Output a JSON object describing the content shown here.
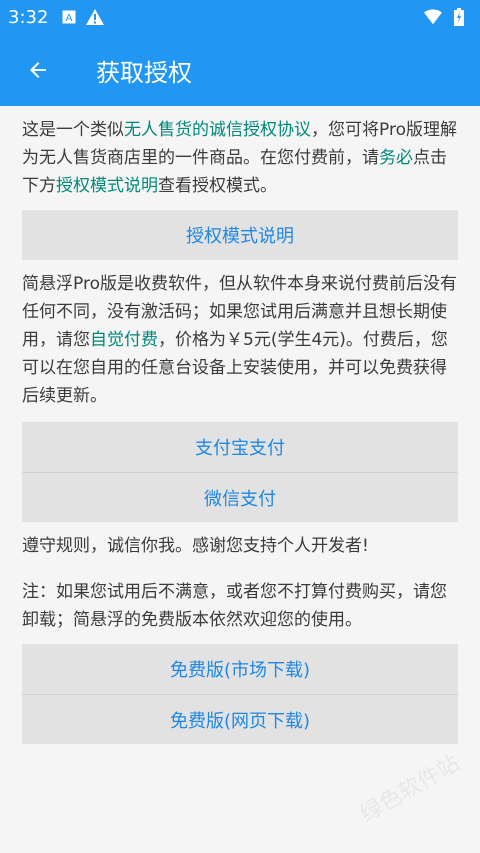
{
  "status": {
    "time": "3:32",
    "icons": [
      "a-box-icon",
      "warning-icon",
      "wifi-icon",
      "battery-icon"
    ]
  },
  "toolbar": {
    "title": "获取授权"
  },
  "intro": {
    "t1": "这是一个类似",
    "link1": "无人售货的诚信授权协议",
    "t2": "，您可将Pro版理解为无人售货商店里的一件商品。在您付费前，请",
    "em": "务必",
    "t3": "点击下方",
    "link2": "授权模式说明",
    "t4": "查看授权模式。"
  },
  "buttons": {
    "mode_desc": "授权模式说明",
    "alipay": "支付宝支付",
    "wechat": "微信支付",
    "free_market": "免费版(市场下载)",
    "free_web": "免费版(网页下载)"
  },
  "desc": {
    "t1": "简悬浮Pro版是收费软件，但从软件本身来说付费前后没有任何不同，没有激活码；如果您试用后满意并且想长期使用，请您",
    "em": "自觉付费",
    "t2": "，价格为￥5元(学生4元)。付费后，您可以在您自用的任意台设备上安装使用，并可以免费获得后续更新。"
  },
  "rules": "遵守规则，诚信你我。感谢您支持个人开发者!",
  "note": "注：如果您试用后不满意，或者您不打算付费购买，请您卸载；简悬浮的免费版本依然欢迎您的使用。",
  "watermark": "绿色软件站",
  "colors": {
    "primary": "#2196f3",
    "accent_text": "#00897b",
    "button_text": "#1e88e5",
    "button_bg": "#e2e2e2"
  }
}
